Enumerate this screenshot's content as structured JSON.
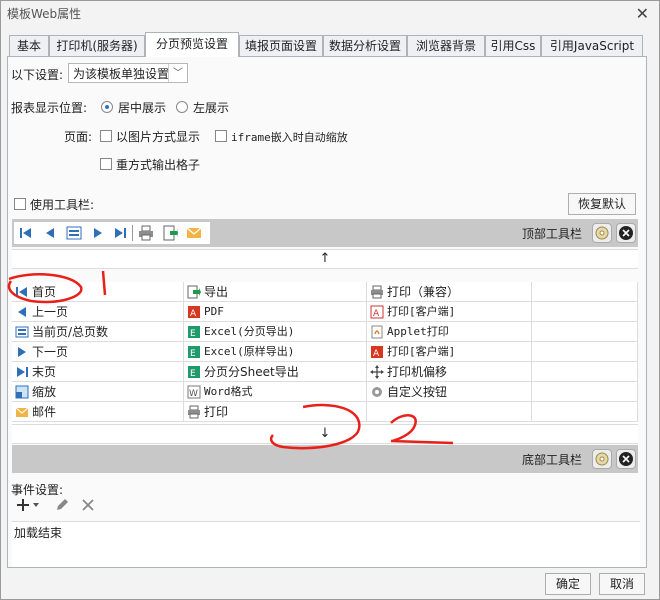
{
  "window": {
    "title": "模板Web属性"
  },
  "tabs": [
    {
      "label": "基本"
    },
    {
      "label": "打印机(服务器)"
    },
    {
      "label": "分页预览设置"
    },
    {
      "label": "填报页面设置"
    },
    {
      "label": "数据分析设置"
    },
    {
      "label": "浏览器背景"
    },
    {
      "label": "引用Css"
    },
    {
      "label": "引用JavaScript"
    }
  ],
  "settings": {
    "scope_label": "以下设置:",
    "scope_value": "为该模板单独设置",
    "position_label": "报表显示位置:",
    "position_center": "居中展示",
    "position_left": "左展示",
    "page_label": "页面:",
    "opt_image": "以图片方式显示",
    "opt_iframe": "iframe嵌入时自动缩放",
    "opt_reprint": "重方式输出格子",
    "use_toolbar": "使用工具栏:",
    "restore_default": "恢复默认"
  },
  "top_toolbar": {
    "label": "顶部工具栏"
  },
  "bottom_toolbar": {
    "label": "底部工具栏"
  },
  "arrows": {
    "up": "↑",
    "down": "↓"
  },
  "buttons_grid": [
    [
      "首页",
      "导出",
      "打印（兼容）"
    ],
    [
      "上一页",
      "PDF",
      "打印[客户端]"
    ],
    [
      "当前页/总页数",
      "Excel(分页导出)",
      "Applet打印"
    ],
    [
      "下一页",
      "Excel(原样导出)",
      "打印[客户端]"
    ],
    [
      "末页",
      "分页分Sheet导出",
      "打印机偏移"
    ],
    [
      "缩放",
      "Word格式",
      "自定义按钮"
    ],
    [
      "邮件",
      "打印",
      ""
    ]
  ],
  "events": {
    "label": "事件设置:",
    "item": "加载结束"
  },
  "footer": {
    "ok": "确定",
    "cancel": "取消"
  },
  "colors": {
    "accent": "#2a72c8",
    "annotation": "#e8201a"
  }
}
